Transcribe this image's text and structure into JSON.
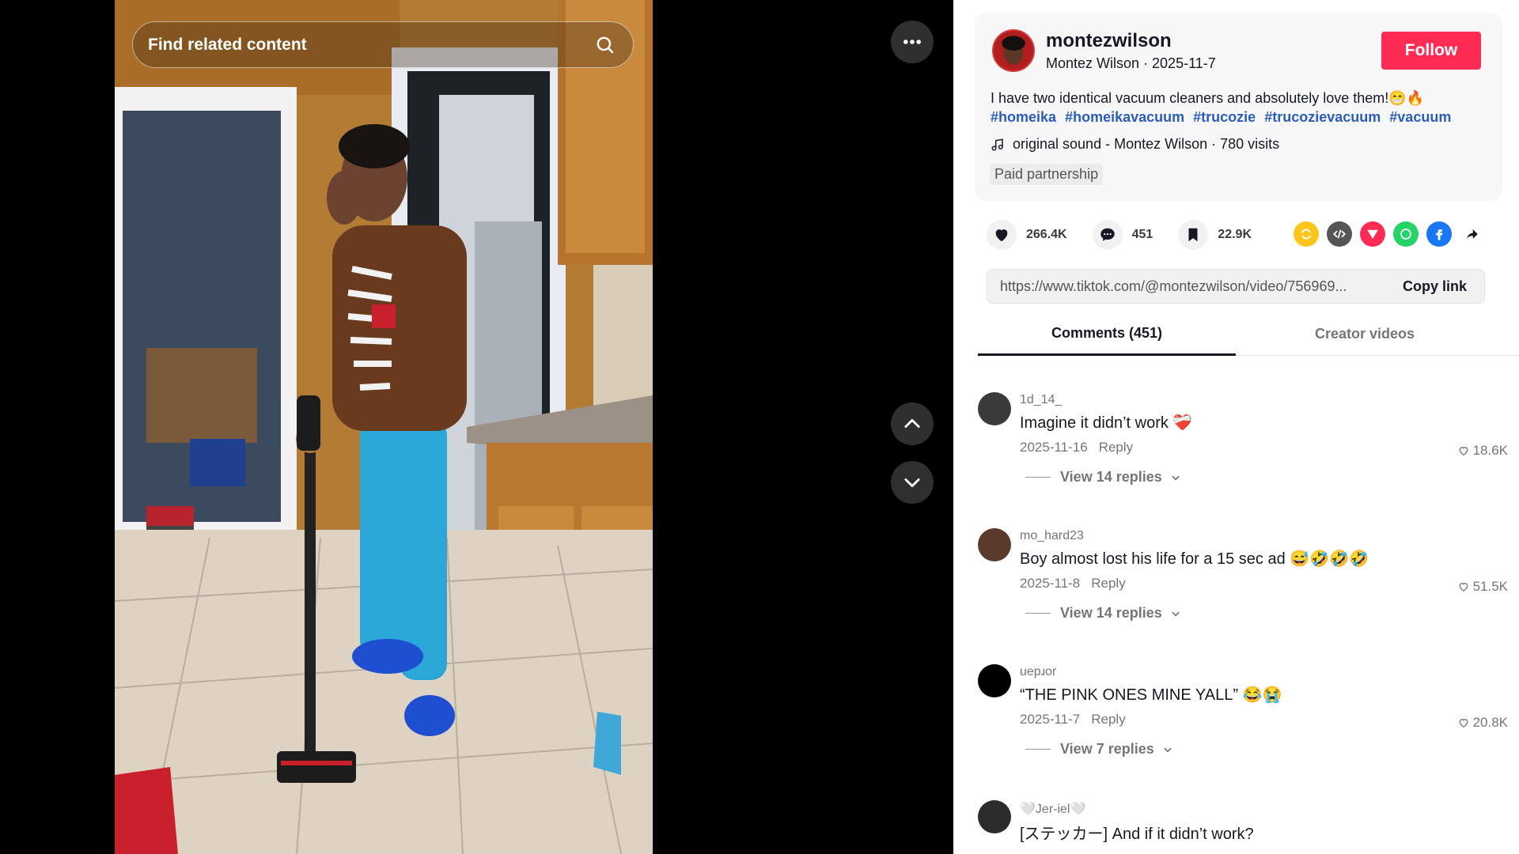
{
  "search": {
    "placeholder": "Find related content"
  },
  "creator": {
    "username": "montezwilson",
    "display": "Montez Wilson · 2025-11-7",
    "follow_label": "Follow"
  },
  "post": {
    "description": "I have two identical vacuum cleaners and absolutely love them!😁🔥",
    "hashtags": [
      "#homeika",
      "#homeikavacuum",
      "#trucozie",
      "#trucozievacuum",
      "#vacuum"
    ],
    "music": "original sound - Montez Wilson · 780 visits",
    "paid_label": "Paid partnership"
  },
  "actions": {
    "likes": "266.4K",
    "comments": "451",
    "saves": "22.9K"
  },
  "share_icons": [
    "repost-icon",
    "embed-icon",
    "send-icon",
    "whatsapp-icon",
    "facebook-icon",
    "share-arrow-icon"
  ],
  "link": {
    "url": "https://www.tiktok.com/@montezwilson/video/756969...",
    "copy_label": "Copy link"
  },
  "tabs": {
    "comments": "Comments (451)",
    "creator": "Creator videos"
  },
  "comments": [
    {
      "user": "1d_14_",
      "text": "Imagine it didn’t work ❤️‍🩹",
      "date": "2025-11-16",
      "reply": "Reply",
      "likes": "18.6K",
      "view": "View 14 replies"
    },
    {
      "user": "mo_hard23",
      "text": "Boy almost lost his life for a 15 sec ad 😅🤣🤣🤣",
      "date": "2025-11-8",
      "reply": "Reply",
      "likes": "51.5K",
      "view": "View 14 replies"
    },
    {
      "user": "uepɹor",
      "text": "“THE PINK ONES MINE YALL” 😂😭",
      "date": "2025-11-7",
      "reply": "Reply",
      "likes": "20.8K",
      "view": "View 7 replies"
    },
    {
      "user": "🤍Jer-iel🤍",
      "text": "[ステッカー] And if it didn’t work?",
      "date": "",
      "reply": "",
      "likes": "",
      "view": ""
    }
  ],
  "colors": {
    "follow": "#fe2c55",
    "hashtag": "#2b5db9"
  }
}
